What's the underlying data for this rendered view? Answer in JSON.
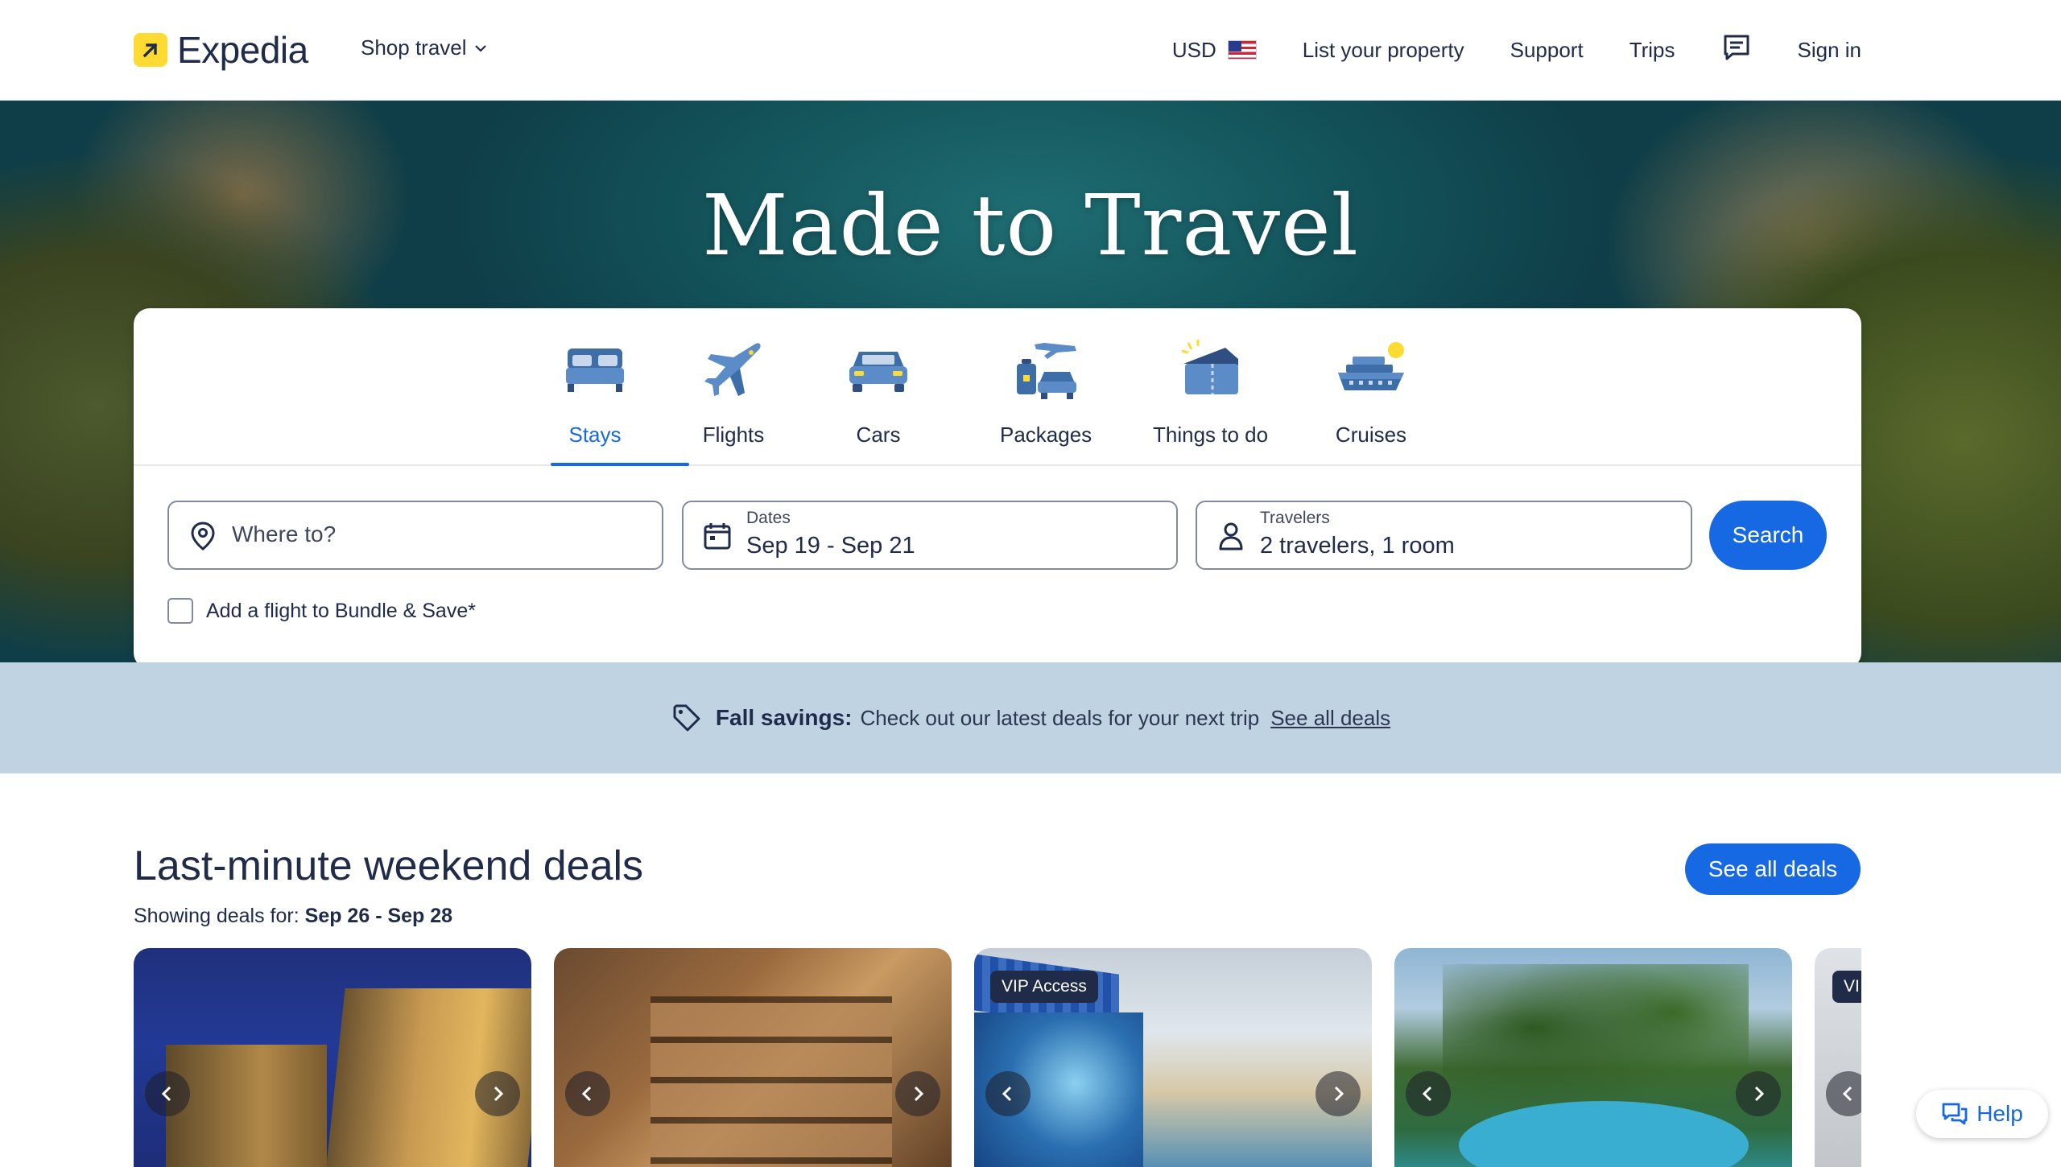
{
  "header": {
    "logo_text": "Expedia",
    "shop_travel": "Shop travel",
    "currency": "USD",
    "list_property": "List your property",
    "support": "Support",
    "trips": "Trips",
    "sign_in": "Sign in"
  },
  "hero": {
    "title": "Made to Travel"
  },
  "search": {
    "tabs": [
      {
        "label": "Stays",
        "icon": "bed-icon",
        "active": true
      },
      {
        "label": "Flights",
        "icon": "airplane-icon",
        "active": false
      },
      {
        "label": "Cars",
        "icon": "car-icon",
        "active": false
      },
      {
        "label": "Packages",
        "icon": "packages-icon",
        "active": false
      },
      {
        "label": "Things to do",
        "icon": "ticket-icon",
        "active": false
      },
      {
        "label": "Cruises",
        "icon": "cruise-ship-icon",
        "active": false
      }
    ],
    "where_placeholder": "Where to?",
    "dates_label": "Dates",
    "dates_value": "Sep 19 - Sep 21",
    "travelers_label": "Travelers",
    "travelers_value": "2 travelers, 1 room",
    "search_button": "Search",
    "bundle_label": "Add a flight to Bundle & Save*",
    "bundle_checked": false
  },
  "promo": {
    "title": "Fall savings:",
    "text": "Check out our latest deals for your next trip",
    "link": "See all deals"
  },
  "deals": {
    "title": "Last-minute weekend deals",
    "showing_label": "Showing deals for:",
    "showing_dates": "Sep 26 - Sep 28",
    "see_all_button": "See all deals",
    "cards": [
      {
        "badge": ""
      },
      {
        "badge": ""
      },
      {
        "badge": "VIP Access"
      },
      {
        "badge": ""
      },
      {
        "badge": "VI"
      }
    ]
  },
  "help": {
    "label": "Help"
  },
  "colors": {
    "brand_blue": "#1668e3",
    "navy": "#1f2b49",
    "logo_yellow": "#fddb32",
    "promo_band": "#bfd3e3"
  }
}
